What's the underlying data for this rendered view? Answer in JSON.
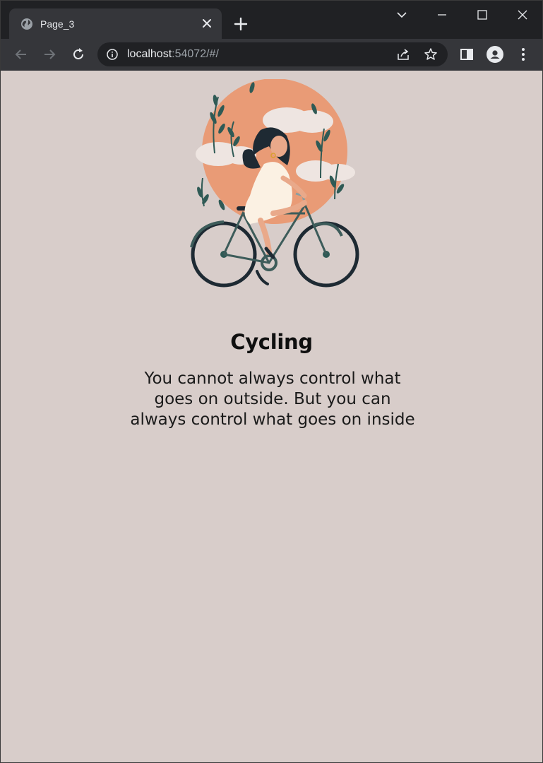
{
  "browser": {
    "tab_title": "Page_3",
    "url_host": "localhost",
    "url_rest": ":54072/#/"
  },
  "icons": {
    "tab_favicon": "globe-icon",
    "tab_close": "close-icon",
    "new_tab": "plus-icon",
    "tab_search": "chevron-down-icon",
    "minimize": "minimize-icon",
    "maximize": "maximize-icon",
    "close_window": "close-icon",
    "back": "arrow-left-icon",
    "forward": "arrow-right-icon",
    "reload": "reload-icon",
    "site_info": "info-icon",
    "share": "share-icon",
    "bookmark": "star-icon",
    "side_panel": "side-panel-icon",
    "profile": "avatar-icon",
    "menu": "kebab-menu-icon"
  },
  "content": {
    "heading": "Cycling",
    "quote": "You cannot always control what goes on outside. But you can always control what goes on inside"
  },
  "colors": {
    "page_background": "#d8cdca",
    "sun": "#e99b76",
    "leaf": "#2f5a55",
    "bike": "#1e2a33",
    "dress": "#fbf1e3"
  }
}
